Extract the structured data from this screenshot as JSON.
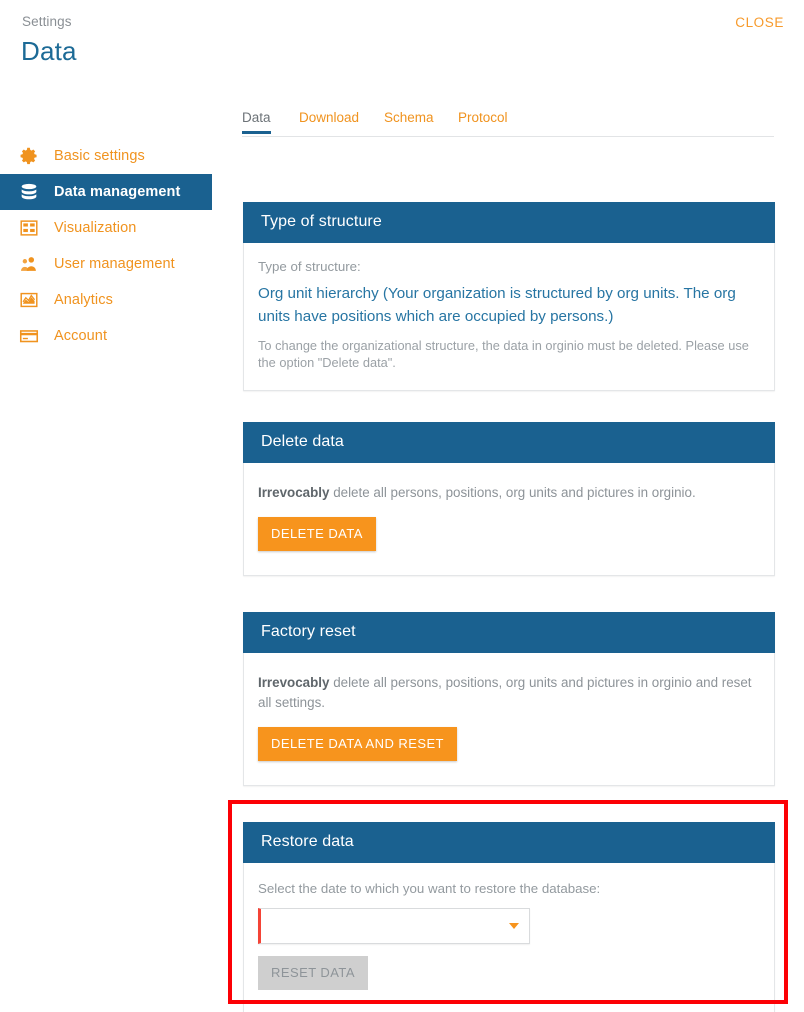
{
  "header": {
    "breadcrumb": "Settings",
    "title": "Data",
    "close_label": "CLOSE"
  },
  "sidebar": {
    "items": [
      {
        "label": "Basic settings",
        "icon": "gear-icon",
        "active": false
      },
      {
        "label": "Data management",
        "icon": "database-icon",
        "active": true
      },
      {
        "label": "Visualization",
        "icon": "grid-icon",
        "active": false
      },
      {
        "label": "User management",
        "icon": "user-icon",
        "active": false
      },
      {
        "label": "Analytics",
        "icon": "chart-icon",
        "active": false
      },
      {
        "label": "Account",
        "icon": "credit-card-icon",
        "active": false
      }
    ]
  },
  "tabs": [
    {
      "label": "Data",
      "active": true
    },
    {
      "label": "Download",
      "active": false
    },
    {
      "label": "Schema",
      "active": false
    },
    {
      "label": "Protocol",
      "active": false
    }
  ],
  "cards": {
    "type_of_structure": {
      "title": "Type of structure",
      "label": "Type of structure:",
      "value": "Org unit hierarchy (Your organization is structured by org units. The org units have positions which are occupied by persons.)",
      "note": "To change the organizational structure, the data in orginio must be deleted. Please use the option \"Delete data\"."
    },
    "delete_data": {
      "title": "Delete data",
      "body_bold": "Irrevocably",
      "body_rest": " delete all persons, positions, org units and pictures in orginio.",
      "button_label": "DELETE DATA"
    },
    "factory_reset": {
      "title": "Factory reset",
      "body_bold": "Irrevocably",
      "body_rest": " delete all persons, positions, org units and pictures in orginio and reset all settings.",
      "button_label": "DELETE DATA AND RESET"
    },
    "restore_data": {
      "title": "Restore data",
      "prompt": "Select the date to which you want to restore the database:",
      "select_value": "",
      "select_placeholder": "",
      "button_label": "RESET DATA"
    }
  },
  "colors": {
    "brand_blue": "#1a6190",
    "accent_orange": "#f7941d",
    "link_blue": "#2775a3",
    "highlight_red": "#fc0005",
    "validation_red": "#f44336"
  }
}
